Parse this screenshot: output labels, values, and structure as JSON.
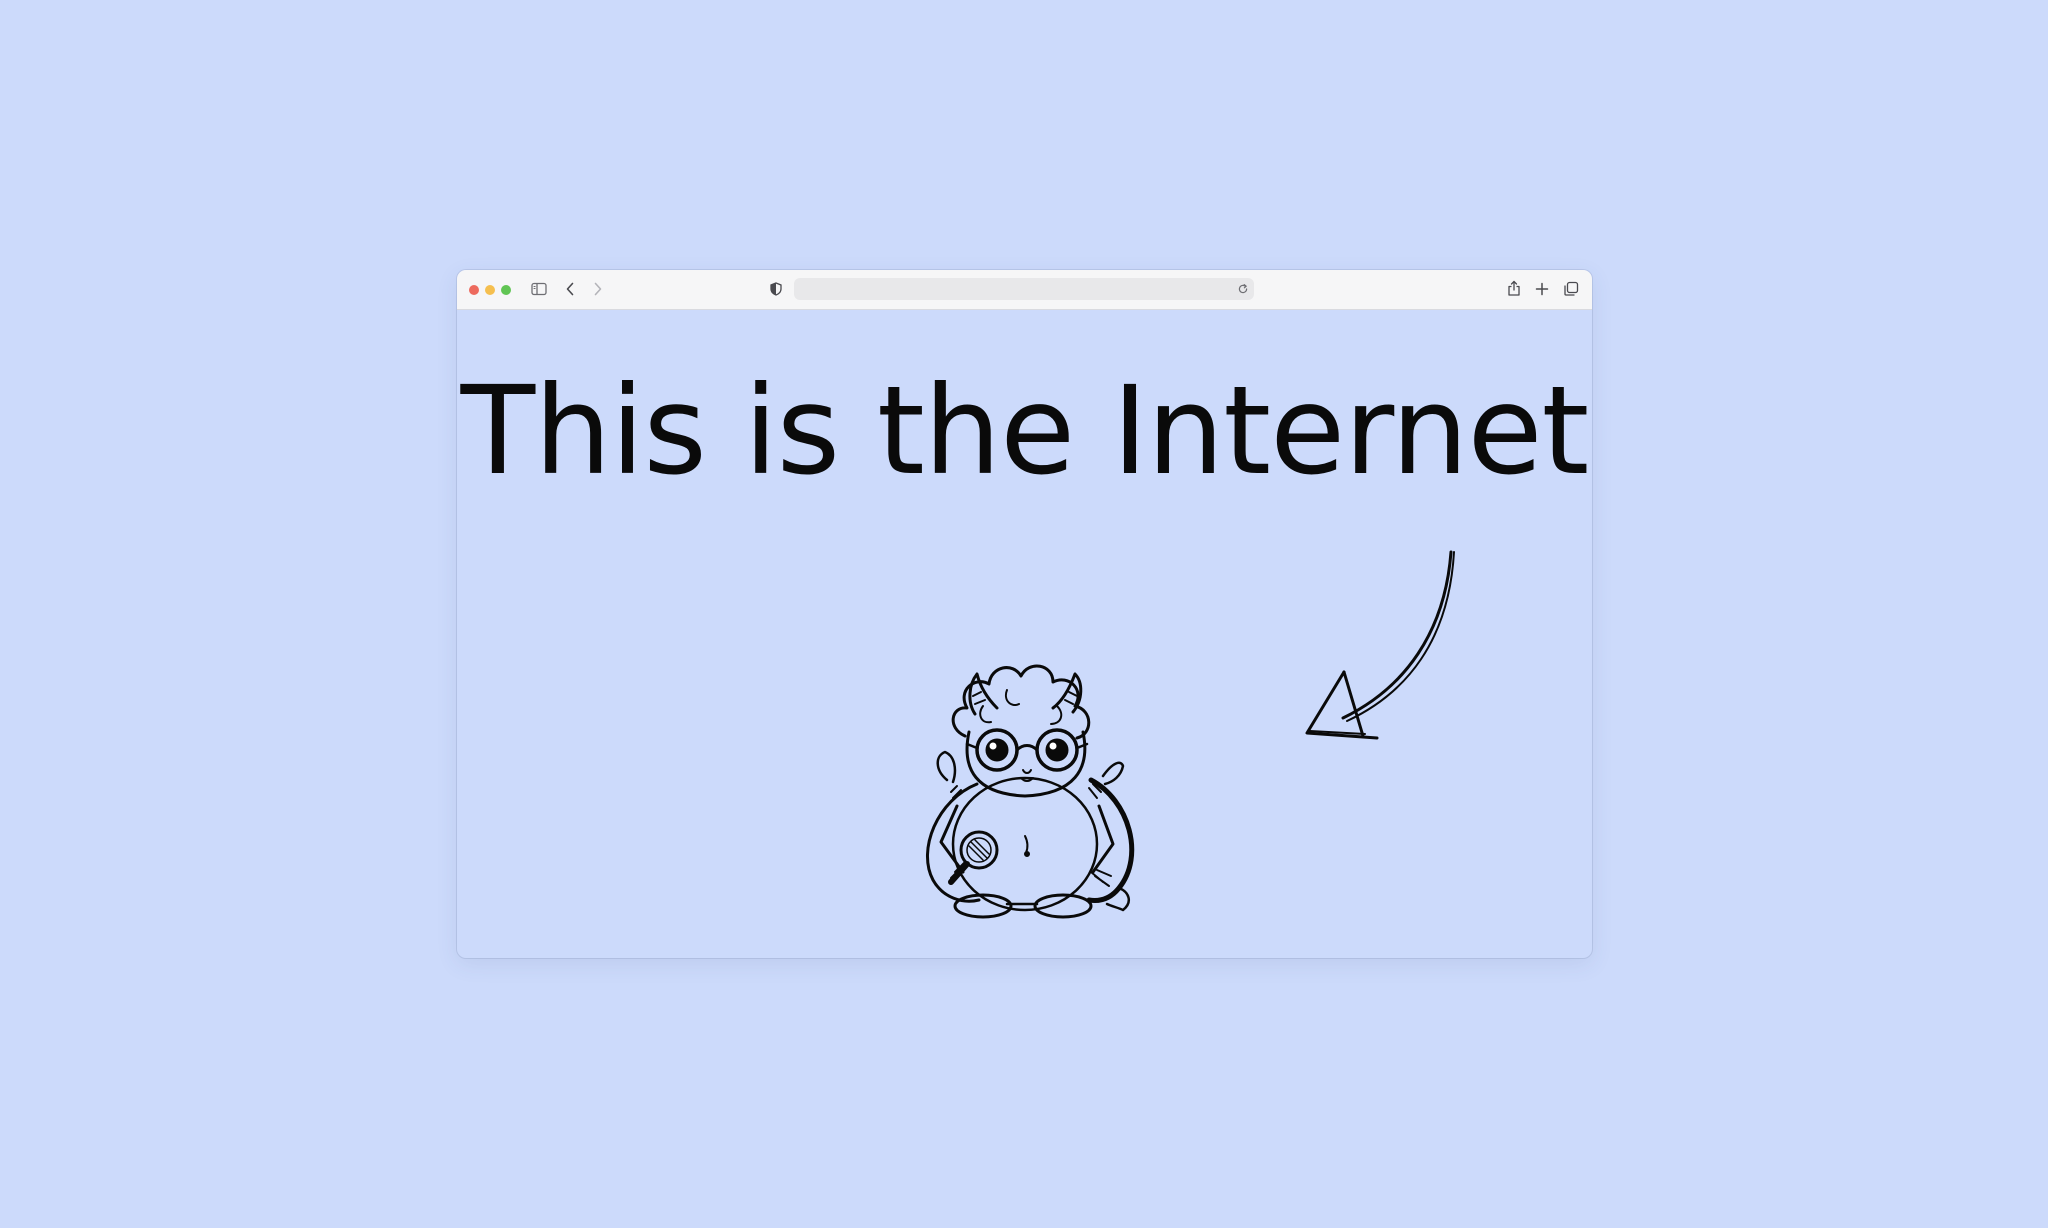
{
  "colors": {
    "background": "#ccdafb",
    "toolbar": "#f6f6f7",
    "traffic_close": "#ed6a5e",
    "traffic_minimize": "#f5bf4f",
    "traffic_zoom": "#61c554",
    "text": "#0a0a0a"
  },
  "toolbar": {
    "window_controls": [
      "close",
      "minimize",
      "zoom"
    ],
    "icons": [
      "sidebar-icon",
      "back-arrow-icon",
      "forward-arrow-icon",
      "privacy-shield-icon",
      "reload-icon",
      "share-icon",
      "plus-icon",
      "tabs-overview-icon"
    ],
    "address_bar": {
      "value": "",
      "placeholder": ""
    }
  },
  "page": {
    "headline": "This is the Internet",
    "illustration": "cartoon-monster-with-magnifying-glass",
    "arrow": "hand-drawn-arrow-pointing-left"
  }
}
